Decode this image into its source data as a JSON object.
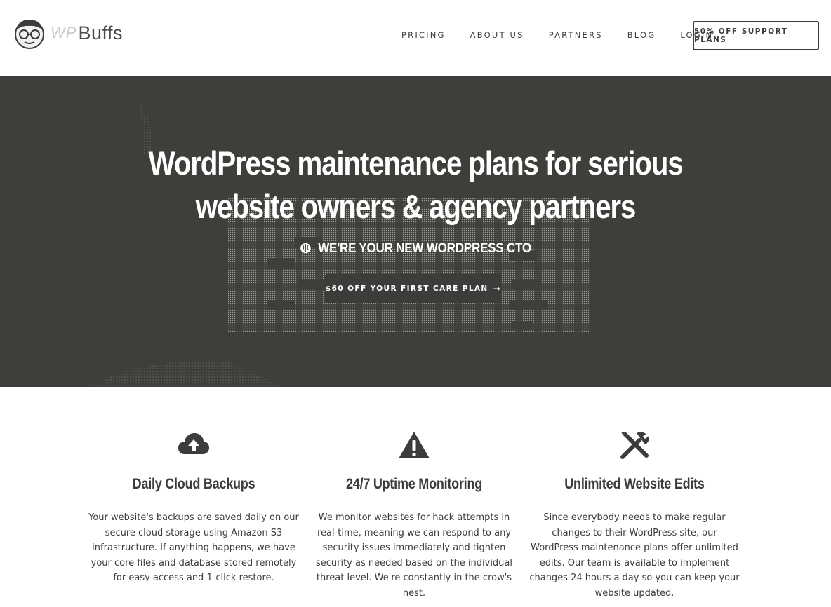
{
  "brand": {
    "logo_prefix": "WP",
    "logo_text": "Buffs"
  },
  "nav": {
    "items": [
      {
        "label": "PRICING"
      },
      {
        "label": "ABOUT US"
      },
      {
        "label": "PARTNERS"
      },
      {
        "label": "BLOG"
      },
      {
        "label": "LOGIN"
      }
    ],
    "cta_label": "50% OFF SUPPORT PLANS"
  },
  "hero": {
    "title_line1": "WordPress maintenance plans for serious",
    "title_line2": "website owners & agency partners",
    "subtitle": "WE'RE YOUR NEW WORDPRESS CTO",
    "subtitle_icon": "brain-icon",
    "button_label": "$60 OFF YOUR FIRST CARE PLAN",
    "button_arrow": "→",
    "background_color": "#3d3f3a"
  },
  "features": [
    {
      "icon": "cloud-upload-icon",
      "title": "Daily Cloud Backups",
      "text": "Your website's backups are saved daily on our secure cloud storage using Amazon S3 infrastructure. If anything happens, we have your core files and database stored remotely for easy access and 1-click restore."
    },
    {
      "icon": "warning-icon",
      "title": "24/7 Uptime Monitoring",
      "text": "We monitor websites for hack attempts in real-time, meaning we can respond to any security issues immediately and tighten security as needed based on the individual threat level. We're constantly in the crow's nest."
    },
    {
      "icon": "tools-icon",
      "title": "Unlimited Website Edits",
      "text": "Since everybody needs to make regular changes to their WordPress site, our WordPress maintenance plans offer unlimited edits. Our team is available to implement changes 24 hours a day so you can keep your website updated."
    }
  ],
  "colors": {
    "text": "#3b3d3a",
    "hero_bg": "#3d3f3a",
    "white": "#ffffff"
  }
}
